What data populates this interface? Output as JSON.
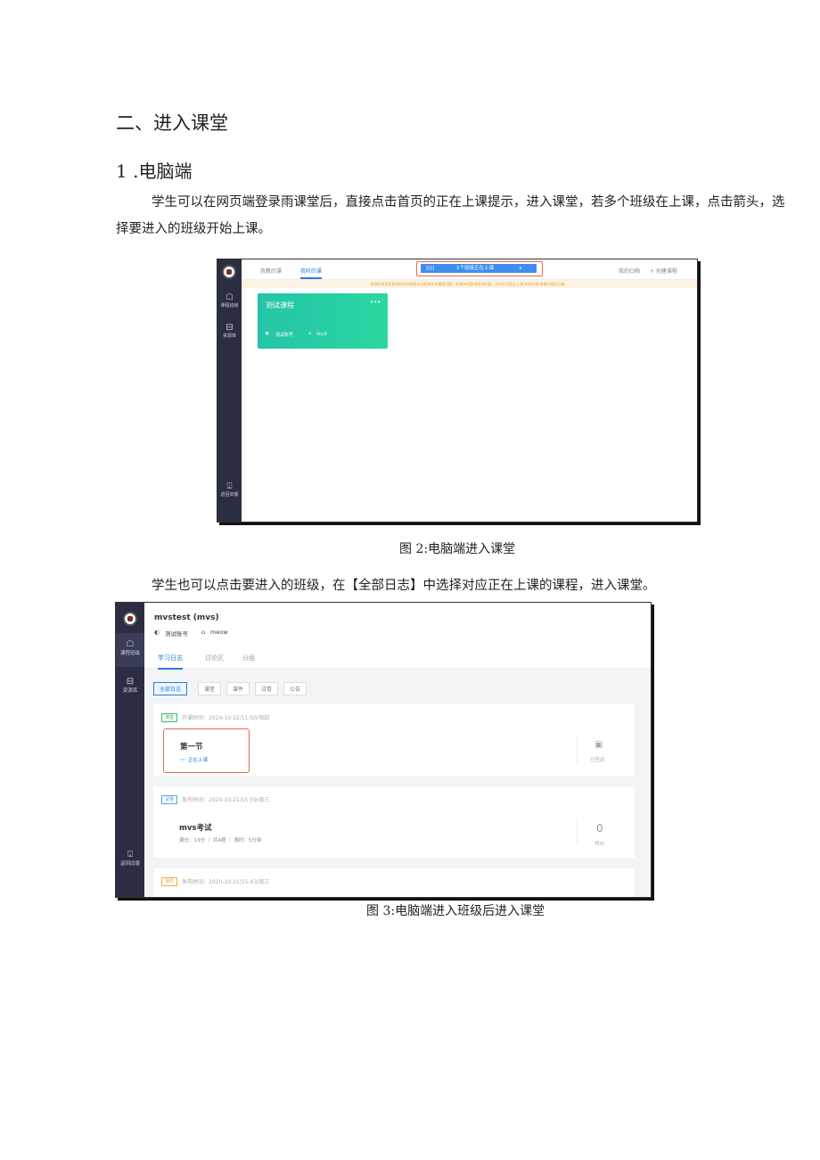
{
  "doc": {
    "section_title": "二、进入课堂",
    "sub_title": "1 .电脑端",
    "para1": "学生可以在网页端登录雨课堂后，直接点击首页的正在上课提示，进入课堂，若多个班级在上课，点击箭头，选择要进入的班级开始上课。",
    "caption1": "图 2:电脑端进入课堂",
    "para2": "学生也可以点击要进入的班级，在【全部日志】中选择对应正在上课的课程，进入课堂。",
    "caption2": "图 3:电脑端进入班级后进入课堂"
  },
  "shot1": {
    "sidebar": {
      "courses_label": "课程班级",
      "resources_label": "资源库",
      "back_label": "返回旧版"
    },
    "tabs": [
      "我教的课",
      "我听的课"
    ],
    "notice": {
      "icon": "|||||",
      "text": "1个班级正在上课",
      "arrow": "∨"
    },
    "top_right": [
      "我的归档",
      "+ 创建课程"
    ],
    "warning": "系统检测到您使用的浏览器版本过低或存在兼容问题，如果有问题请尝试升级，可以在页面右上角‘系统升级’查看升级后功能。",
    "card": {
      "title": "测试课程",
      "more": "•••",
      "teacher": "测试账号",
      "class": "0cc0"
    }
  },
  "shot2": {
    "sidebar": {
      "courses_label": "课程班级",
      "resources_label": "资源库",
      "back_label": "返回旧版"
    },
    "course_title": "mvstest (mvs)",
    "teacher": "测试账号",
    "class_name": "meow",
    "tabs": [
      "学习日志",
      "讨论区",
      "分组"
    ],
    "filters": [
      "全部日志",
      "课堂",
      "课件",
      "试卷",
      "公告"
    ],
    "items": [
      {
        "tag": "课堂",
        "meta": "开课时间：2020-10-22/11:50/周四",
        "title": "第一节",
        "status": "正在上课",
        "right_label": "已签到"
      },
      {
        "tag": "试卷",
        "meta": "发布时间：2020-10-21/15:59/周三",
        "title": "mvs考试",
        "detail": "满分：13分 ｜ 共4题 ｜ 限时：5分钟",
        "score": "0",
        "score_label": "得分"
      },
      {
        "tag": "课件",
        "meta": "发布时间：2020-10-21/15:43/周三"
      }
    ]
  },
  "colors": {
    "accent": "#2a7de1",
    "highlight": "#e36b4a",
    "card_green": "#27cfa4",
    "sidebar": "#2b2d42"
  }
}
